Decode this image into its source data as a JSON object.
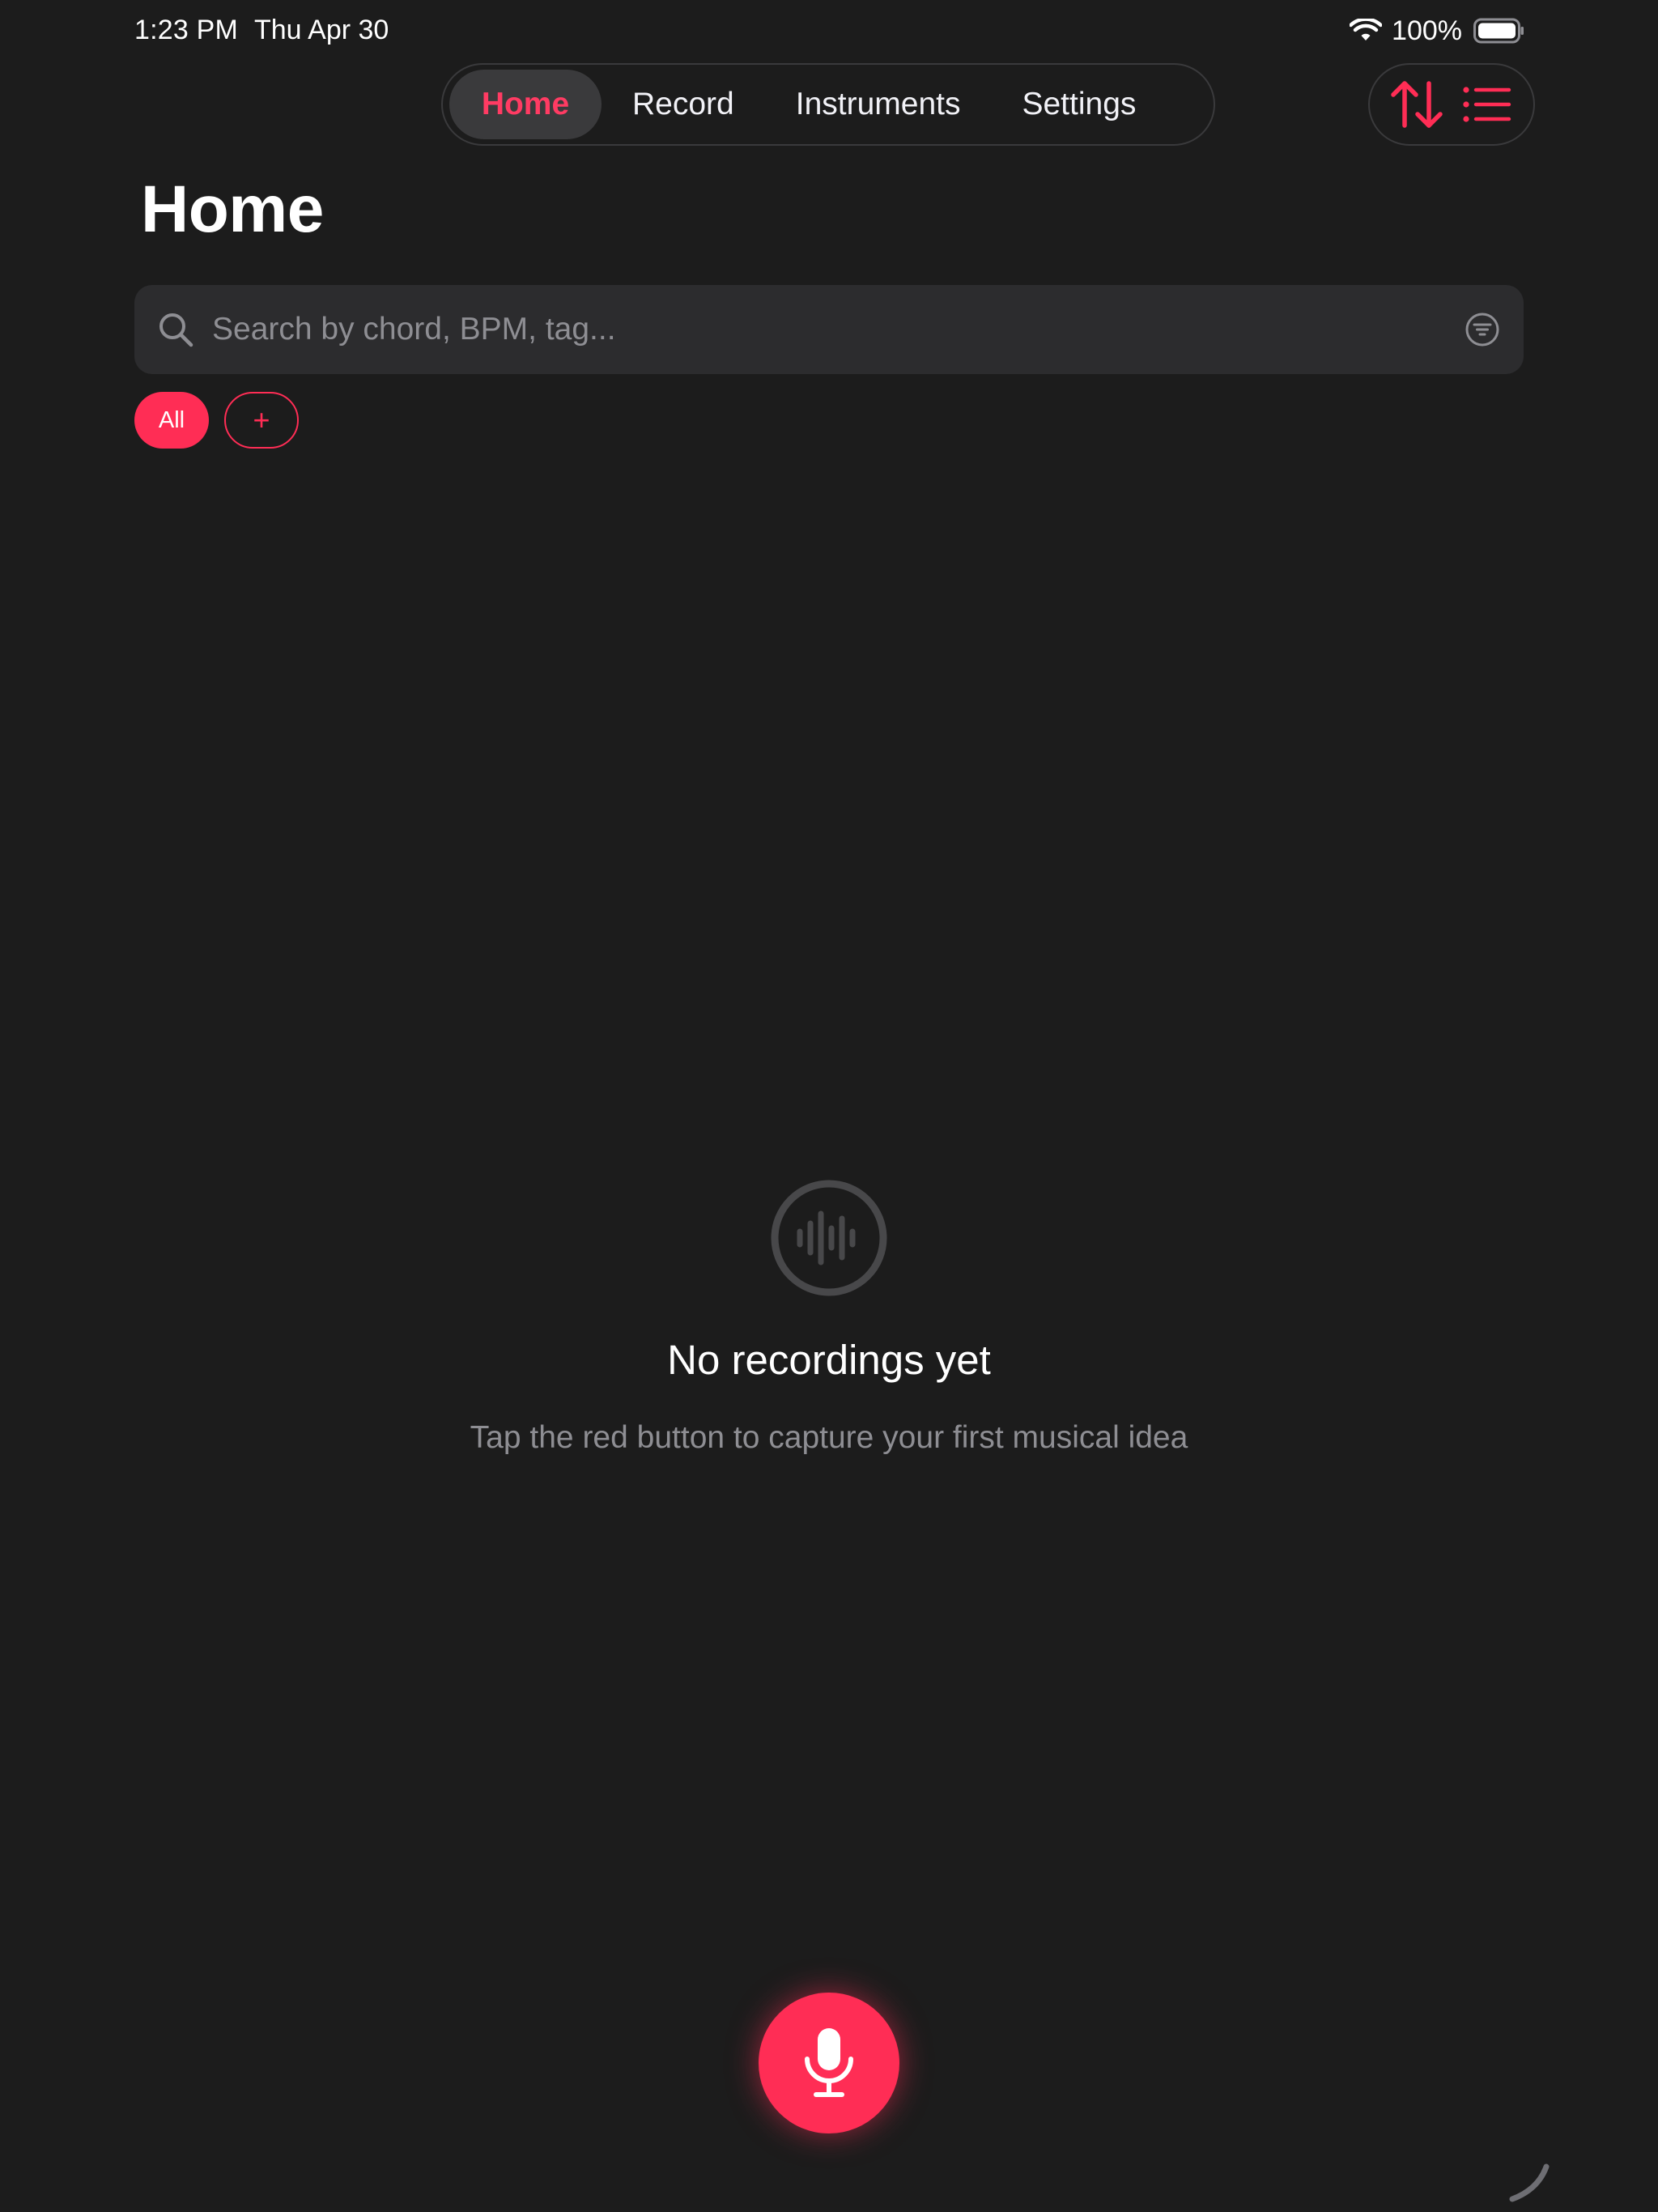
{
  "status_bar": {
    "time": "1:23 PM",
    "date": "Thu Apr 30",
    "battery": "100%",
    "icons": [
      "wifi-icon",
      "battery-icon"
    ]
  },
  "nav": {
    "tabs": [
      {
        "label": "Home",
        "active": true
      },
      {
        "label": "Record",
        "active": false
      },
      {
        "label": "Instruments",
        "active": false
      },
      {
        "label": "Settings",
        "active": false
      }
    ],
    "tools": [
      "sort-arrows-icon",
      "list-icon"
    ]
  },
  "page": {
    "title": "Home"
  },
  "search": {
    "placeholder": "Search by chord, BPM, tag...",
    "value": "",
    "icons": [
      "search-icon",
      "filter-icon"
    ]
  },
  "chips": {
    "all_label": "All",
    "add_label": "+"
  },
  "empty_state": {
    "icon": "waveform-circle-icon",
    "title": "No recordings yet",
    "subtitle": "Tap the red button to capture your first musical idea"
  },
  "fab": {
    "icon": "microphone-icon"
  },
  "colors": {
    "accent": "#ff2d55",
    "background": "#1c1c1c",
    "surface": "#2c2c2e",
    "muted_text": "#8e8e93",
    "active_tab_bg": "#3a3a3c"
  }
}
